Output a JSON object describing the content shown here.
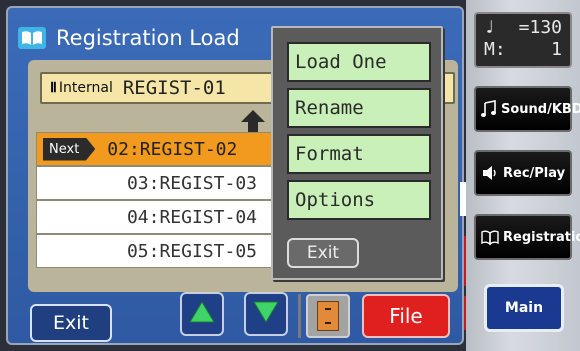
{
  "header": {
    "title": "Registration Load",
    "icon": "book-icon"
  },
  "current": {
    "source_icon": "Ⅱ",
    "source_label": "Internal",
    "name": "REGIST-01"
  },
  "list": {
    "next_badge": "Next",
    "items": [
      {
        "label": "02:REGIST-02",
        "selected": true
      },
      {
        "label": "03:REGIST-03",
        "selected": false
      },
      {
        "label": "04:REGIST-04",
        "selected": false
      },
      {
        "label": "05:REGIST-05",
        "selected": false
      }
    ]
  },
  "popup": {
    "items": [
      "Load One",
      "Rename",
      "Format",
      "Options"
    ],
    "exit_label": "Exit"
  },
  "bottom": {
    "exit_label": "Exit",
    "file_label": "File"
  },
  "side": {
    "tempo_symbol": "♩",
    "tempo_value": "=130",
    "measure_label": "M:",
    "measure_value": "1",
    "buttons": [
      "Sound/KBD",
      "Rec/Play",
      "Registration"
    ],
    "main_label": "Main"
  },
  "colors": {
    "screen_blue": "#3b6bb8",
    "selected_orange": "#f29a1e",
    "menu_green": "#c9f0b8",
    "file_red": "#e0201f",
    "arrow_green": "#3fd46a"
  }
}
